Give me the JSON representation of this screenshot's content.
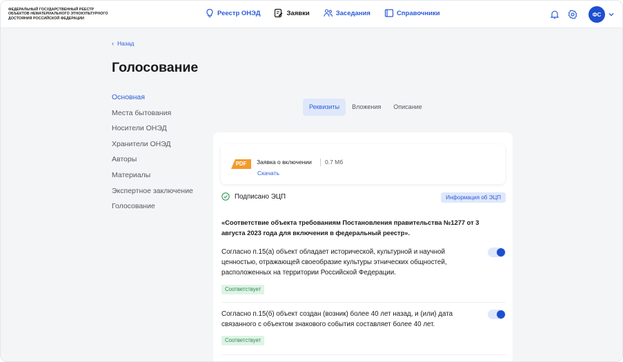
{
  "header": {
    "org_line1": "ФЕДЕРАЛЬНЫЙ ГОСУДАРСТВЕННЫЙ РЕЕСТР",
    "org_line2": "ОБЪЕКТОВ НЕМАТЕРИАЛЬНОГО ЭТНОКУЛЬТУРНОГО",
    "org_line3": "ДОСТОЯНИЯ РОССИЙСКОЙ ФЕДЕРАЦИИ",
    "nav": [
      {
        "label": "Реестр ОНЭД",
        "icon": "lightbulb-icon"
      },
      {
        "label": "Заявки",
        "icon": "document-edit-icon",
        "active": true
      },
      {
        "label": "Заседания",
        "icon": "people-icon"
      },
      {
        "label": "Справочники",
        "icon": "book-icon"
      }
    ],
    "avatar_initials": "ФС"
  },
  "back_label": "Назад",
  "page_title": "Голосование",
  "sidebar": {
    "items": [
      {
        "label": "Основная",
        "active": true
      },
      {
        "label": "Места бытования"
      },
      {
        "label": "Носители ОНЭД"
      },
      {
        "label": "Хранители ОНЭД"
      },
      {
        "label": "Авторы"
      },
      {
        "label": "Материалы"
      },
      {
        "label": "Экспертное заключение"
      },
      {
        "label": "Голосование"
      }
    ]
  },
  "tabs": [
    {
      "label": "Реквизиты",
      "active": true
    },
    {
      "label": "Вложения"
    },
    {
      "label": "Описание"
    }
  ],
  "file": {
    "type_label": "PDF",
    "name": "Заявка о включении",
    "size": "0.7 Мб",
    "download_label": "Скачать"
  },
  "signature": {
    "label": "Подписано ЭЦП",
    "info_button": "Информация об ЭЦП"
  },
  "criteria_heading": "«Соответствие объекта требованиям Постановления правительства №1277 от 3 августа 2023 года для включения в федеральный реестр».",
  "criteria": [
    {
      "text": "Согласно п.15(а) объект обладает исторической, культурной и научной ценностью, отражающей своеобразие культуры этнических общностей, расположенных на территории Российской Федерации.",
      "status": "Соответствует",
      "toggle_on": true
    },
    {
      "text": "Согласно п.15(б) объект создан (возник) более 40 лет назад, и (или) дата связанного с объектом знакового события составляет более 40 лет.",
      "status": "Соответствует",
      "toggle_on": true
    }
  ],
  "colors": {
    "accent": "#2a5bd7",
    "toggle_knob": "#1e4fd0",
    "pdf_badge": "#f39a2c",
    "success_text": "#2e8a4e",
    "success_bg": "#dff3e6"
  }
}
